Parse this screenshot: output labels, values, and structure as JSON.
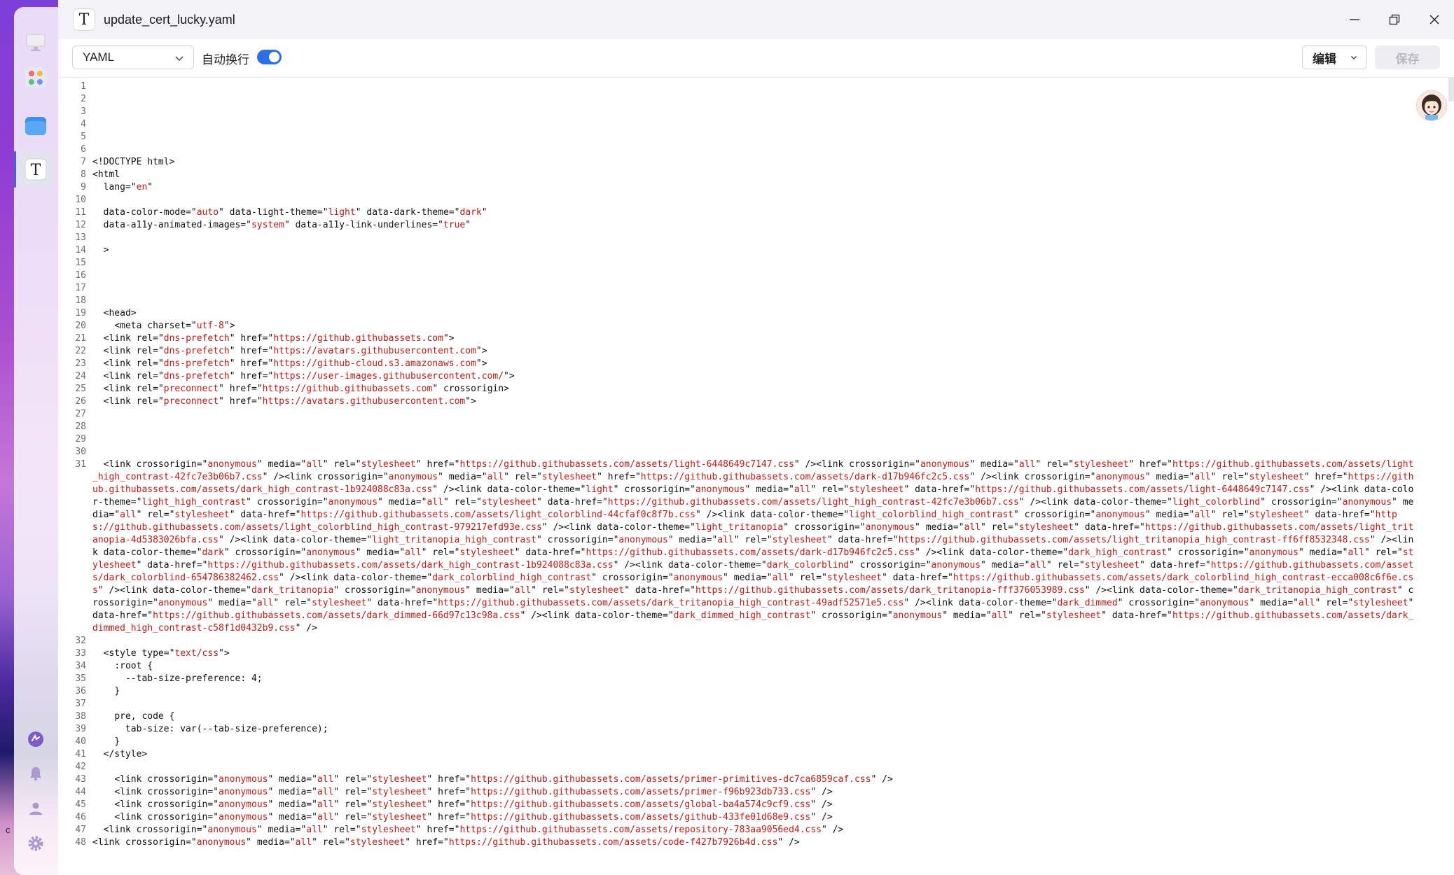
{
  "window": {
    "title": "update_cert_lucky.yaml",
    "app_icon_glyph": "T"
  },
  "toolbar": {
    "language": "YAML",
    "wrap_label": "自动换行",
    "wrap_enabled": true,
    "edit_label": "编辑",
    "save_label": "保存"
  },
  "dock": {
    "items": [
      {
        "name": "desktop-icon"
      },
      {
        "name": "app-center-icon"
      },
      {
        "name": "file-manager-icon"
      },
      {
        "name": "text-editor-icon",
        "active": true
      },
      {
        "name": "sync-icon"
      },
      {
        "name": "bell-icon"
      },
      {
        "name": "user-icon"
      },
      {
        "name": "settings-icon"
      }
    ],
    "stray_text": "c"
  },
  "colors": {
    "accent": "#2c6fe6",
    "string": "#c41a16",
    "line_number": "#6c6c6c"
  },
  "editor": {
    "lines": [
      {
        "n": "1",
        "t": ""
      },
      {
        "n": "2",
        "t": ""
      },
      {
        "n": "3",
        "t": ""
      },
      {
        "n": "4",
        "t": ""
      },
      {
        "n": "5",
        "t": ""
      },
      {
        "n": "6",
        "t": ""
      },
      {
        "n": "7",
        "t": "<!DOCTYPE html>"
      },
      {
        "n": "8",
        "t": "<html"
      },
      {
        "n": "9",
        "t": "  lang=\"en\""
      },
      {
        "n": "10",
        "t": ""
      },
      {
        "n": "11",
        "t": "  data-color-mode=\"auto\" data-light-theme=\"light\" data-dark-theme=\"dark\""
      },
      {
        "n": "12",
        "t": "  data-a11y-animated-images=\"system\" data-a11y-link-underlines=\"true\""
      },
      {
        "n": "13",
        "t": ""
      },
      {
        "n": "14",
        "t": "  >"
      },
      {
        "n": "15",
        "t": ""
      },
      {
        "n": "16",
        "t": ""
      },
      {
        "n": "17",
        "t": ""
      },
      {
        "n": "18",
        "t": ""
      },
      {
        "n": "19",
        "t": "  <head>"
      },
      {
        "n": "20",
        "t": "    <meta charset=\"utf-8\">"
      },
      {
        "n": "21",
        "t": "  <link rel=\"dns-prefetch\" href=\"https://github.githubassets.com\">"
      },
      {
        "n": "22",
        "t": "  <link rel=\"dns-prefetch\" href=\"https://avatars.githubusercontent.com\">"
      },
      {
        "n": "23",
        "t": "  <link rel=\"dns-prefetch\" href=\"https://github-cloud.s3.amazonaws.com\">"
      },
      {
        "n": "24",
        "t": "  <link rel=\"dns-prefetch\" href=\"https://user-images.githubusercontent.com/\">"
      },
      {
        "n": "25",
        "t": "  <link rel=\"preconnect\" href=\"https://github.githubassets.com\" crossorigin>"
      },
      {
        "n": "26",
        "t": "  <link rel=\"preconnect\" href=\"https://avatars.githubusercontent.com\">"
      },
      {
        "n": "27",
        "t": ""
      },
      {
        "n": "28",
        "t": ""
      },
      {
        "n": "29",
        "t": ""
      },
      {
        "n": "30",
        "t": ""
      },
      {
        "n": "31",
        "t": "  <link crossorigin=\"anonymous\" media=\"all\" rel=\"stylesheet\" href=\"https://github.githubassets.com/assets/light-6448649c7147.css\" /><link crossorigin=\"anonymous\" media=\"all\" rel=\"stylesheet\" href=\"https://github.githubassets.com/assets/light_high_contrast-42fc7e3b06b7.css\" /><link crossorigin=\"anonymous\" media=\"all\" rel=\"stylesheet\" href=\"https://github.githubassets.com/assets/dark-d17b946fc2c5.css\" /><link crossorigin=\"anonymous\" media=\"all\" rel=\"stylesheet\" href=\"https://github.githubassets.com/assets/dark_high_contrast-1b924088c83a.css\" /><link data-color-theme=\"light\" crossorigin=\"anonymous\" media=\"all\" rel=\"stylesheet\" data-href=\"https://github.githubassets.com/assets/light-6448649c7147.css\" /><link data-color-theme=\"light_high_contrast\" crossorigin=\"anonymous\" media=\"all\" rel=\"stylesheet\" data-href=\"https://github.githubassets.com/assets/light_high_contrast-42fc7e3b06b7.css\" /><link data-color-theme=\"light_colorblind\" crossorigin=\"anonymous\" media=\"all\" rel=\"stylesheet\" data-href=\"https://github.githubassets.com/assets/light_colorblind-44cfaf0c8f7b.css\" /><link data-color-theme=\"light_colorblind_high_contrast\" crossorigin=\"anonymous\" media=\"all\" rel=\"stylesheet\" data-href=\"https://github.githubassets.com/assets/light_colorblind_high_contrast-979217efd93e.css\" /><link data-color-theme=\"light_tritanopia\" crossorigin=\"anonymous\" media=\"all\" rel=\"stylesheet\" data-href=\"https://github.githubassets.com/assets/light_tritanopia-4d5383026bfa.css\" /><link data-color-theme=\"light_tritanopia_high_contrast\" crossorigin=\"anonymous\" media=\"all\" rel=\"stylesheet\" data-href=\"https://github.githubassets.com/assets/light_tritanopia_high_contrast-ff6ff8532348.css\" /><link data-color-theme=\"dark\" crossorigin=\"anonymous\" media=\"all\" rel=\"stylesheet\" data-href=\"https://github.githubassets.com/assets/dark-d17b946fc2c5.css\" /><link data-color-theme=\"dark_high_contrast\" crossorigin=\"anonymous\" media=\"all\" rel=\"stylesheet\" data-href=\"https://github.githubassets.com/assets/dark_high_contrast-1b924088c83a.css\" /><link data-color-theme=\"dark_colorblind\" crossorigin=\"anonymous\" media=\"all\" rel=\"stylesheet\" data-href=\"https://github.githubassets.com/assets/dark_colorblind-654786382462.css\" /><link data-color-theme=\"dark_colorblind_high_contrast\" crossorigin=\"anonymous\" media=\"all\" rel=\"stylesheet\" data-href=\"https://github.githubassets.com/assets/dark_colorblind_high_contrast-ecca008c6f6e.css\" /><link data-color-theme=\"dark_tritanopia\" crossorigin=\"anonymous\" media=\"all\" rel=\"stylesheet\" data-href=\"https://github.githubassets.com/assets/dark_tritanopia-fff376053989.css\" /><link data-color-theme=\"dark_tritanopia_high_contrast\" crossorigin=\"anonymous\" media=\"all\" rel=\"stylesheet\" data-href=\"https://github.githubassets.com/assets/dark_tritanopia_high_contrast-49adf52571e5.css\" /><link data-color-theme=\"dark_dimmed\" crossorigin=\"anonymous\" media=\"all\" rel=\"stylesheet\" data-href=\"https://github.githubassets.com/assets/dark_dimmed-66d97c13c98a.css\" /><link data-color-theme=\"dark_dimmed_high_contrast\" crossorigin=\"anonymous\" media=\"all\" rel=\"stylesheet\" data-href=\"https://github.githubassets.com/assets/dark_dimmed_high_contrast-c58f1d0432b9.css\" />"
      },
      {
        "n": "32",
        "t": ""
      },
      {
        "n": "33",
        "t": "  <style type=\"text/css\">"
      },
      {
        "n": "34",
        "t": "    :root {"
      },
      {
        "n": "35",
        "t": "      --tab-size-preference: 4;"
      },
      {
        "n": "36",
        "t": "    }"
      },
      {
        "n": "37",
        "t": ""
      },
      {
        "n": "38",
        "t": "    pre, code {"
      },
      {
        "n": "39",
        "t": "      tab-size: var(--tab-size-preference);"
      },
      {
        "n": "40",
        "t": "    }"
      },
      {
        "n": "41",
        "t": "  </style>"
      },
      {
        "n": "42",
        "t": ""
      },
      {
        "n": "43",
        "t": "    <link crossorigin=\"anonymous\" media=\"all\" rel=\"stylesheet\" href=\"https://github.githubassets.com/assets/primer-primitives-dc7ca6859caf.css\" />"
      },
      {
        "n": "44",
        "t": "    <link crossorigin=\"anonymous\" media=\"all\" rel=\"stylesheet\" href=\"https://github.githubassets.com/assets/primer-f96b923db733.css\" />"
      },
      {
        "n": "45",
        "t": "    <link crossorigin=\"anonymous\" media=\"all\" rel=\"stylesheet\" href=\"https://github.githubassets.com/assets/global-ba4a574c9cf9.css\" />"
      },
      {
        "n": "46",
        "t": "    <link crossorigin=\"anonymous\" media=\"all\" rel=\"stylesheet\" href=\"https://github.githubassets.com/assets/github-433fe01d68e9.css\" />"
      },
      {
        "n": "47",
        "t": "  <link crossorigin=\"anonymous\" media=\"all\" rel=\"stylesheet\" href=\"https://github.githubassets.com/assets/repository-783aa9056ed4.css\" />"
      },
      {
        "n": "48",
        "t": "<link crossorigin=\"anonymous\" media=\"all\" rel=\"stylesheet\" href=\"https://github.githubassets.com/assets/code-f427b7926b4d.css\" />"
      }
    ]
  }
}
